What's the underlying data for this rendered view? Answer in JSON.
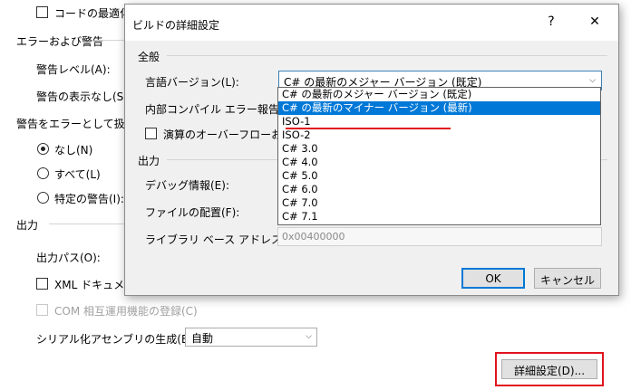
{
  "background_page": {
    "optimize_code_label": "コードの最適化(Z",
    "errors_warnings_heading": "エラーおよび警告",
    "warning_level_label": "警告レベル(A):",
    "suppress_warnings_label": "警告の表示なし(S):",
    "treat_warnings_heading": "警告をエラーとして扱う",
    "radio_none_label": "なし(N)",
    "radio_all_label": "すべて(L)",
    "radio_specific_label": "特定の警告(I):",
    "output_heading": "出力",
    "output_path_label": "出力パス(O):",
    "xml_doc_label": "XML ドキュメント",
    "com_interop_label": "COM 相互運用機能の登録(C)",
    "serialization_label": "シリアル化アセンブリの生成(E):",
    "serialization_value": "自動",
    "advanced_button_label": "詳細設定(D)..."
  },
  "dialog": {
    "title": "ビルドの詳細設定",
    "help_button": "?",
    "close_button": "✕",
    "general_group": "全般",
    "lang_version_label": "言語バージョン(L):",
    "lang_version_value": "C# の最新のメジャー バージョン (既定)",
    "internal_compiler_label": "内部コンパイル エラー報告(I):",
    "overflow_label": "演算のオーバーフローおよびア",
    "output_group": "出力",
    "debug_info_label": "デバッグ情報(E):",
    "file_alignment_label": "ファイルの配置(F):",
    "dll_base_label": "ライブラリ ベース アドレス(B):",
    "dll_base_value": "0x00400000",
    "ok_label": "OK",
    "cancel_label": "キャンセル"
  },
  "dropdown": {
    "items": [
      "C# の最新のメジャー バージョン (既定)",
      "C# の最新のマイナー バージョン (最新)",
      "ISO-1",
      "ISO-2",
      "C# 3.0",
      "C# 4.0",
      "C# 5.0",
      "C# 6.0",
      "C# 7.0",
      "C# 7.1"
    ],
    "selected_index": 1
  },
  "colors": {
    "highlight": "#0078d7",
    "annotation_red": "#e0141e"
  }
}
